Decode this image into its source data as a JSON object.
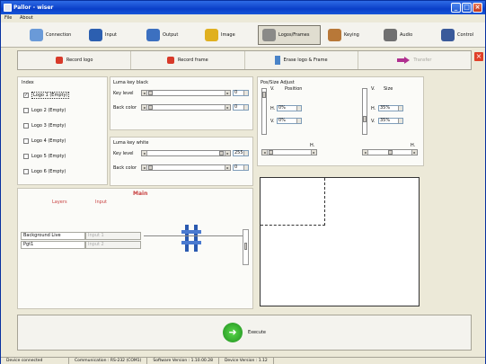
{
  "window": {
    "title": "Pallor - wiser"
  },
  "menu": [
    "File",
    "About"
  ],
  "toolbar": [
    {
      "label": "Connection",
      "icon": "connection-icon",
      "color": "#6a9ad8"
    },
    {
      "label": "Input",
      "icon": "input-icon",
      "color": "#2c5fb0"
    },
    {
      "label": "Output",
      "icon": "output-icon",
      "color": "#3c70c0"
    },
    {
      "label": "Image",
      "icon": "image-icon",
      "color": "#e0b020"
    },
    {
      "label": "Logos/Frames",
      "icon": "logos-frames-icon",
      "color": "#8a8a88"
    },
    {
      "label": "Keying",
      "icon": "keying-icon",
      "color": "#b87838"
    },
    {
      "label": "Audio",
      "icon": "audio-icon",
      "color": "#707070"
    },
    {
      "label": "Control",
      "icon": "control-icon",
      "color": "#3a5a9a"
    }
  ],
  "subtoolbar": {
    "record_logo": "Record logo",
    "record_frame": "Record frame",
    "erase": "Erase logo & Frame",
    "transfer": "Transfer"
  },
  "index": {
    "title": "Index",
    "items": [
      {
        "label": "Logo 1 (Empty)",
        "checked": true
      },
      {
        "label": "Logo 2 (Empty)",
        "checked": false
      },
      {
        "label": "Logo 3 (Empty)",
        "checked": false
      },
      {
        "label": "Logo 4 (Empty)",
        "checked": false
      },
      {
        "label": "Logo 5 (Empty)",
        "checked": false
      },
      {
        "label": "Logo 6 (Empty)",
        "checked": false
      }
    ]
  },
  "luma_black": {
    "title": "Luma key black",
    "key_level_label": "Key level",
    "key_level_value": "0",
    "back_color_label": "Back color",
    "back_color_value": "0"
  },
  "luma_white": {
    "title": "Luma key white",
    "key_level_label": "Key level",
    "key_level_value": "255",
    "back_color_label": "Back color",
    "back_color_value": "0"
  },
  "pos_size": {
    "title": "Pos/Size Adjust",
    "v_label": "V.",
    "h_label": "H.",
    "position_label": "Position",
    "size_label": "Size",
    "pos_h": "0%",
    "pos_v": "0%",
    "size_h": "35%",
    "size_v": "35%"
  },
  "main": {
    "title": "Main",
    "layer_label": "Layers",
    "input_label": "Input",
    "rows": [
      {
        "layer": "Background Live",
        "input": "Input 1"
      },
      {
        "layer": "Pgt1",
        "input": "Input 2"
      }
    ]
  },
  "execute": {
    "label": "Execute"
  },
  "status": {
    "device": "Device connected",
    "communication": "Communication : RS-232 (COM1)",
    "software": "Software Version : 1.10.00.28",
    "device_version": "Device Version : 1.12"
  }
}
